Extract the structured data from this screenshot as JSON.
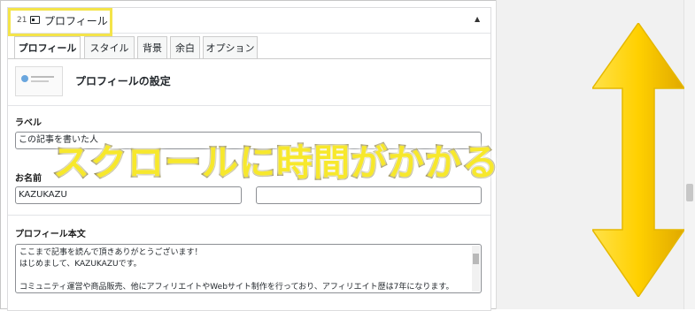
{
  "block": {
    "number": "21",
    "title": "プロフィール",
    "collapse_glyph": "▲"
  },
  "tabs": [
    {
      "label": "プロフィール",
      "active": true
    },
    {
      "label": "スタイル",
      "active": false
    },
    {
      "label": "背景",
      "active": false
    },
    {
      "label": "余白",
      "active": false
    },
    {
      "label": "オプション",
      "active": false
    }
  ],
  "settings": {
    "title": "プロフィールの設定"
  },
  "fields": {
    "label_title": "ラベル",
    "label_value": "この記事を書いた人",
    "name_title": "お名前",
    "name_value": "KAZUKAZU",
    "second_value": "",
    "body_title": "プロフィール本文",
    "body_lines": [
      "ここまで記事を読んで頂きありがとうございます！",
      "はじめまして、KAZUKAZUです。",
      "",
      "コミュニティ運営や商品販売、他にアフィリエイトやWebサイト制作を行っており、アフィリエイト歴は7年になります。"
    ]
  },
  "overlay": {
    "caption": "スクロールに時間がかかる",
    "caption_color": "#f7e82c",
    "arrow_color": "#ffd400"
  },
  "icons": {
    "block": "profile-card-icon",
    "collapse": "collapse-up-icon",
    "arrow": "vertical-double-arrow-icon"
  }
}
